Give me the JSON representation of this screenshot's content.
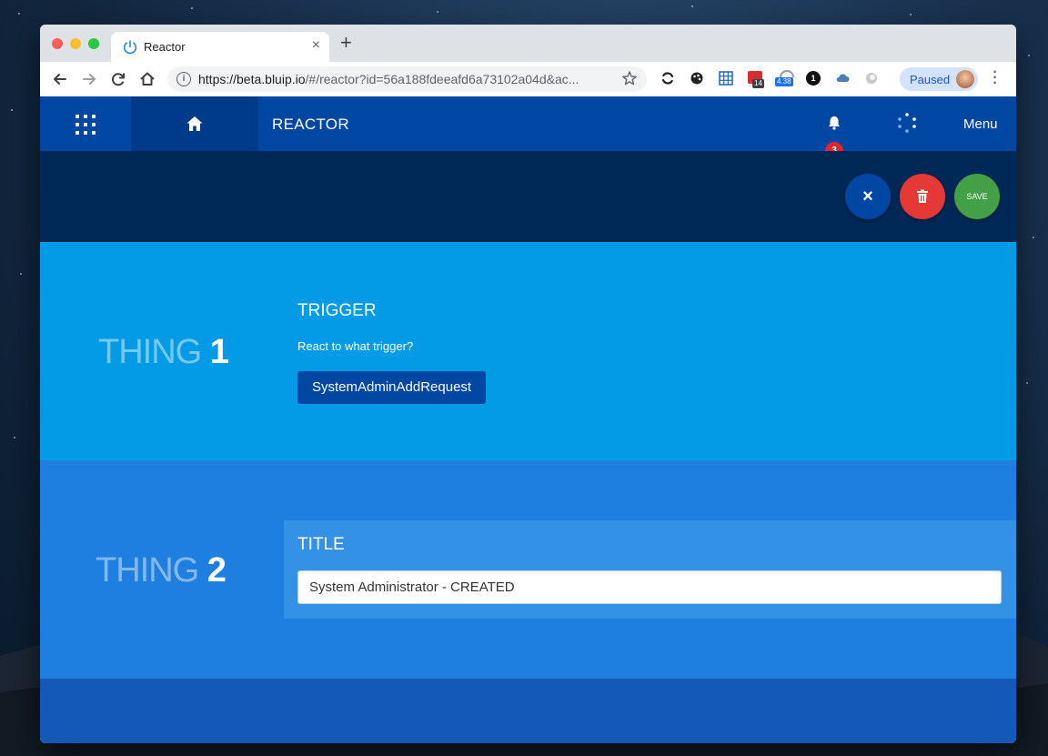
{
  "browser": {
    "tab_title": "Reactor",
    "tab_close": "×",
    "new_tab": "+",
    "url_host": "https://beta.bluip.io",
    "url_rest": "/#/reactor?id=56a188fdeeafd6a73102a04d&ac...",
    "profile_status": "Paused",
    "ext_badge_1": "14",
    "ext_badge_2": "4.38",
    "ext_badge_3": "1"
  },
  "appbar": {
    "title": "REACTOR",
    "notifications_count": "3",
    "menu_label": "Menu"
  },
  "actions": {
    "close_icon": "×",
    "save_label": "SAVE"
  },
  "thing1": {
    "word": "THING",
    "number": "1",
    "heading": "TRIGGER",
    "question": "React to what trigger?",
    "trigger_value": "SystemAdminAddRequest"
  },
  "thing2": {
    "word": "THING",
    "number": "2",
    "heading": "TITLE",
    "title_value": "System Administrator - CREATED"
  },
  "colors": {
    "appbar": "#0047a3",
    "actionbar": "#002856",
    "section1": "#039be5",
    "section2": "#1e7fe0",
    "delete": "#e53935",
    "save": "#43a047"
  }
}
